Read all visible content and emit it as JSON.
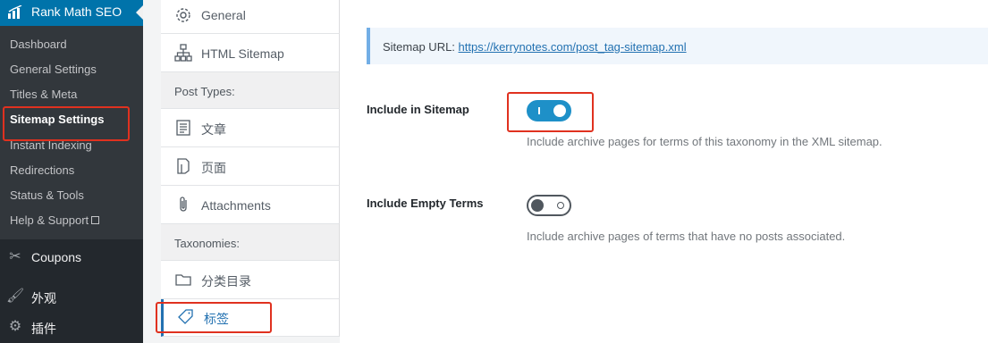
{
  "sidebar": {
    "plugin_title": "Rank Math SEO",
    "plugin_icon": "rank-math-chart-icon",
    "submenu": [
      {
        "label": "Dashboard"
      },
      {
        "label": "General Settings"
      },
      {
        "label": "Titles & Meta"
      },
      {
        "label": "Sitemap Settings",
        "current": true
      },
      {
        "label": "Instant Indexing"
      },
      {
        "label": "Redirections"
      },
      {
        "label": "Status & Tools"
      },
      {
        "label": "Help & Support",
        "icon": "external-link-icon"
      }
    ],
    "menu": [
      {
        "label": "Coupons",
        "icon": "scissors-icon"
      },
      {
        "label": "外观",
        "icon": "paintbrush-icon"
      },
      {
        "label": "插件",
        "icon": "plugin-icon"
      }
    ]
  },
  "tabs": {
    "general": "General",
    "html_sitemap": "HTML Sitemap",
    "post_types_heading": "Post Types:",
    "post_types": [
      "文章",
      "页面",
      "Attachments"
    ],
    "taxonomies_heading": "Taxonomies:",
    "taxonomies": [
      "分类目录",
      "标签"
    ],
    "active": "标签"
  },
  "main": {
    "sitemap_url_label": "Sitemap URL:",
    "sitemap_url": "https://kerrynotes.com/post_tag-sitemap.xml",
    "fields": [
      {
        "label": "Include in Sitemap",
        "enabled": true,
        "description": "Include archive pages for terms of this taxonomy in the XML sitemap."
      },
      {
        "label": "Include Empty Terms",
        "enabled": false,
        "description": "Include archive pages of terms that have no posts associated."
      }
    ]
  },
  "colors": {
    "sidebar_bg": "#23282d",
    "submenu_bg": "#32373c",
    "accent": "#0073aa",
    "toggle_on": "#1e90c8",
    "highlight": "#e0311f"
  }
}
